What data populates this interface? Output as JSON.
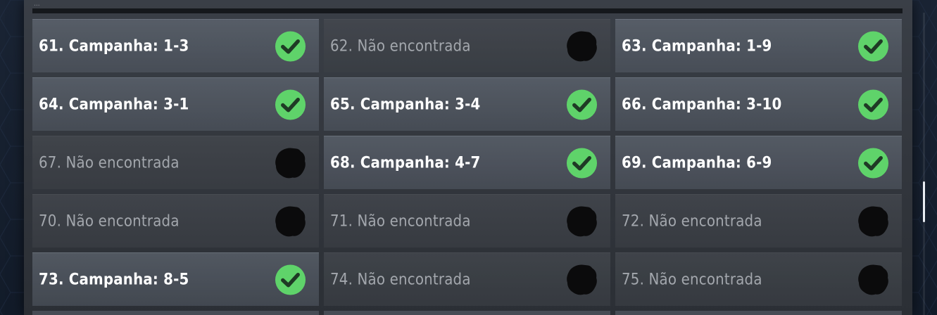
{
  "top_stub_text": "...",
  "cells": [
    {
      "label": "61. Campanha: 1-3",
      "status": "complete"
    },
    {
      "label": "62. Não encontrada",
      "status": "locked"
    },
    {
      "label": "63. Campanha: 1-9",
      "status": "complete"
    },
    {
      "label": "64. Campanha: 3-1",
      "status": "complete"
    },
    {
      "label": "65. Campanha: 3-4",
      "status": "complete"
    },
    {
      "label": "66. Campanha: 3-10",
      "status": "complete"
    },
    {
      "label": "67. Não encontrada",
      "status": "locked"
    },
    {
      "label": "68. Campanha: 4-7",
      "status": "complete"
    },
    {
      "label": "69. Campanha: 6-9",
      "status": "complete"
    },
    {
      "label": "70. Não encontrada",
      "status": "locked"
    },
    {
      "label": "71. Não encontrada",
      "status": "locked"
    },
    {
      "label": "72. Não encontrada",
      "status": "locked"
    },
    {
      "label": "73. Campanha: 8-5",
      "status": "complete"
    },
    {
      "label": "74. Não encontrada",
      "status": "locked"
    },
    {
      "label": "75. Não encontrada",
      "status": "locked"
    }
  ],
  "icons": {
    "complete": "check-circle-icon",
    "locked": "undiscovered-blot-icon"
  },
  "colors": {
    "check_fill": "#5fd36a",
    "check_mark": "#1f3a25",
    "blot": "#0b0b0c",
    "label_found": "#ffffff",
    "label_locked": "#a3a7ad"
  }
}
